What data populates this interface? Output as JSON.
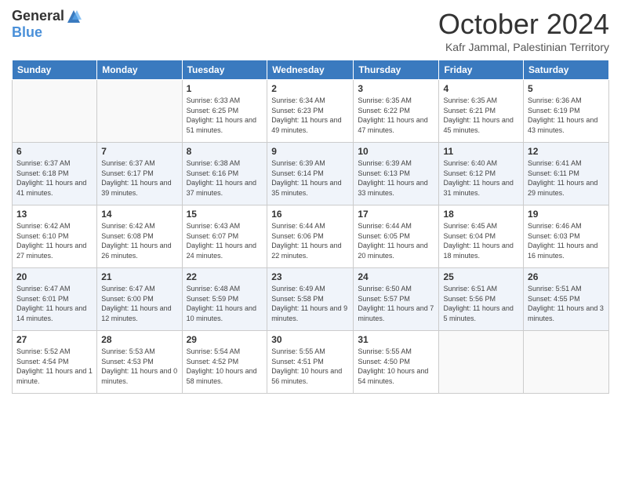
{
  "logo": {
    "general": "General",
    "blue": "Blue"
  },
  "header": {
    "month": "October 2024",
    "location": "Kafr Jammal, Palestinian Territory"
  },
  "days_of_week": [
    "Sunday",
    "Monday",
    "Tuesday",
    "Wednesday",
    "Thursday",
    "Friday",
    "Saturday"
  ],
  "weeks": [
    [
      {
        "day": "",
        "info": ""
      },
      {
        "day": "",
        "info": ""
      },
      {
        "day": "1",
        "info": "Sunrise: 6:33 AM\nSunset: 6:25 PM\nDaylight: 11 hours and 51 minutes."
      },
      {
        "day": "2",
        "info": "Sunrise: 6:34 AM\nSunset: 6:23 PM\nDaylight: 11 hours and 49 minutes."
      },
      {
        "day": "3",
        "info": "Sunrise: 6:35 AM\nSunset: 6:22 PM\nDaylight: 11 hours and 47 minutes."
      },
      {
        "day": "4",
        "info": "Sunrise: 6:35 AM\nSunset: 6:21 PM\nDaylight: 11 hours and 45 minutes."
      },
      {
        "day": "5",
        "info": "Sunrise: 6:36 AM\nSunset: 6:19 PM\nDaylight: 11 hours and 43 minutes."
      }
    ],
    [
      {
        "day": "6",
        "info": "Sunrise: 6:37 AM\nSunset: 6:18 PM\nDaylight: 11 hours and 41 minutes."
      },
      {
        "day": "7",
        "info": "Sunrise: 6:37 AM\nSunset: 6:17 PM\nDaylight: 11 hours and 39 minutes."
      },
      {
        "day": "8",
        "info": "Sunrise: 6:38 AM\nSunset: 6:16 PM\nDaylight: 11 hours and 37 minutes."
      },
      {
        "day": "9",
        "info": "Sunrise: 6:39 AM\nSunset: 6:14 PM\nDaylight: 11 hours and 35 minutes."
      },
      {
        "day": "10",
        "info": "Sunrise: 6:39 AM\nSunset: 6:13 PM\nDaylight: 11 hours and 33 minutes."
      },
      {
        "day": "11",
        "info": "Sunrise: 6:40 AM\nSunset: 6:12 PM\nDaylight: 11 hours and 31 minutes."
      },
      {
        "day": "12",
        "info": "Sunrise: 6:41 AM\nSunset: 6:11 PM\nDaylight: 11 hours and 29 minutes."
      }
    ],
    [
      {
        "day": "13",
        "info": "Sunrise: 6:42 AM\nSunset: 6:10 PM\nDaylight: 11 hours and 27 minutes."
      },
      {
        "day": "14",
        "info": "Sunrise: 6:42 AM\nSunset: 6:08 PM\nDaylight: 11 hours and 26 minutes."
      },
      {
        "day": "15",
        "info": "Sunrise: 6:43 AM\nSunset: 6:07 PM\nDaylight: 11 hours and 24 minutes."
      },
      {
        "day": "16",
        "info": "Sunrise: 6:44 AM\nSunset: 6:06 PM\nDaylight: 11 hours and 22 minutes."
      },
      {
        "day": "17",
        "info": "Sunrise: 6:44 AM\nSunset: 6:05 PM\nDaylight: 11 hours and 20 minutes."
      },
      {
        "day": "18",
        "info": "Sunrise: 6:45 AM\nSunset: 6:04 PM\nDaylight: 11 hours and 18 minutes."
      },
      {
        "day": "19",
        "info": "Sunrise: 6:46 AM\nSunset: 6:03 PM\nDaylight: 11 hours and 16 minutes."
      }
    ],
    [
      {
        "day": "20",
        "info": "Sunrise: 6:47 AM\nSunset: 6:01 PM\nDaylight: 11 hours and 14 minutes."
      },
      {
        "day": "21",
        "info": "Sunrise: 6:47 AM\nSunset: 6:00 PM\nDaylight: 11 hours and 12 minutes."
      },
      {
        "day": "22",
        "info": "Sunrise: 6:48 AM\nSunset: 5:59 PM\nDaylight: 11 hours and 10 minutes."
      },
      {
        "day": "23",
        "info": "Sunrise: 6:49 AM\nSunset: 5:58 PM\nDaylight: 11 hours and 9 minutes."
      },
      {
        "day": "24",
        "info": "Sunrise: 6:50 AM\nSunset: 5:57 PM\nDaylight: 11 hours and 7 minutes."
      },
      {
        "day": "25",
        "info": "Sunrise: 6:51 AM\nSunset: 5:56 PM\nDaylight: 11 hours and 5 minutes."
      },
      {
        "day": "26",
        "info": "Sunrise: 5:51 AM\nSunset: 4:55 PM\nDaylight: 11 hours and 3 minutes."
      }
    ],
    [
      {
        "day": "27",
        "info": "Sunrise: 5:52 AM\nSunset: 4:54 PM\nDaylight: 11 hours and 1 minute."
      },
      {
        "day": "28",
        "info": "Sunrise: 5:53 AM\nSunset: 4:53 PM\nDaylight: 11 hours and 0 minutes."
      },
      {
        "day": "29",
        "info": "Sunrise: 5:54 AM\nSunset: 4:52 PM\nDaylight: 10 hours and 58 minutes."
      },
      {
        "day": "30",
        "info": "Sunrise: 5:55 AM\nSunset: 4:51 PM\nDaylight: 10 hours and 56 minutes."
      },
      {
        "day": "31",
        "info": "Sunrise: 5:55 AM\nSunset: 4:50 PM\nDaylight: 10 hours and 54 minutes."
      },
      {
        "day": "",
        "info": ""
      },
      {
        "day": "",
        "info": ""
      }
    ]
  ]
}
